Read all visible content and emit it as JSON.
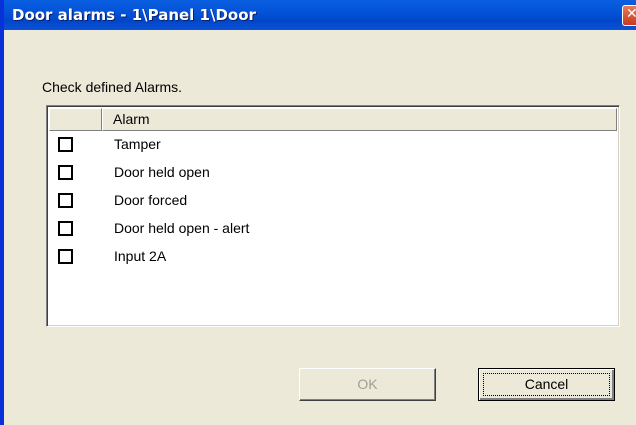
{
  "window": {
    "title": "Door alarms - 1\\Panel 1\\Door",
    "close_glyph": "✕"
  },
  "instruction": "Check defined Alarms.",
  "list": {
    "header": "Alarm",
    "items": [
      {
        "label": "Tamper",
        "checked": false
      },
      {
        "label": "Door held open",
        "checked": false
      },
      {
        "label": "Door forced",
        "checked": false
      },
      {
        "label": "Door held open - alert",
        "checked": false
      },
      {
        "label": "Input 2A",
        "checked": false
      }
    ]
  },
  "buttons": {
    "ok_label": "OK",
    "ok_enabled": false,
    "cancel_label": "Cancel"
  },
  "colors": {
    "titlebar": "#0A52D6",
    "background": "#ECE9D8",
    "disabled_text": "#A09F94"
  }
}
